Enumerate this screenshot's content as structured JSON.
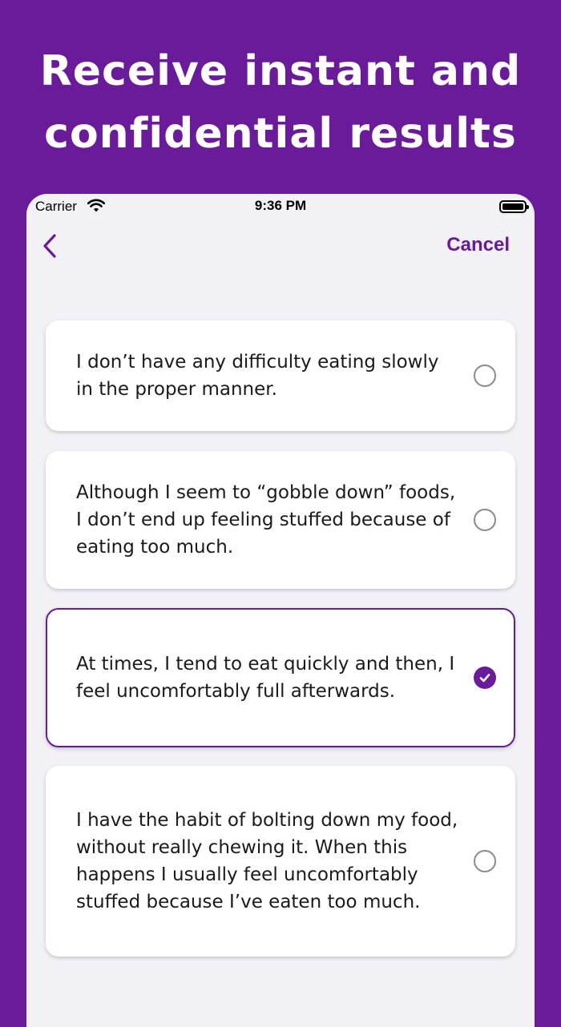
{
  "headline": {
    "line1": "Receive instant and",
    "line2": "confidential results"
  },
  "status_bar": {
    "carrier": "Carrier",
    "time": "9:36 PM"
  },
  "nav": {
    "cancel_label": "Cancel"
  },
  "options": [
    {
      "text": "I don’t have any difficulty eating slowly in the proper manner.",
      "selected": false
    },
    {
      "text": "Although I seem to “gobble down” foods, I don’t end up feeling stuffed because of eating too much.",
      "selected": false
    },
    {
      "text": "At times, I tend to eat quickly and then, I feel uncomfortably full afterwards.",
      "selected": true
    },
    {
      "text": "I have the habit of bolting down my food, without really chewing it. When this happens I usually feel uncomfortably stuffed because I’ve eaten too much.",
      "selected": false
    }
  ],
  "colors": {
    "brand": "#6a1b9a",
    "background": "#f2f1f6"
  }
}
